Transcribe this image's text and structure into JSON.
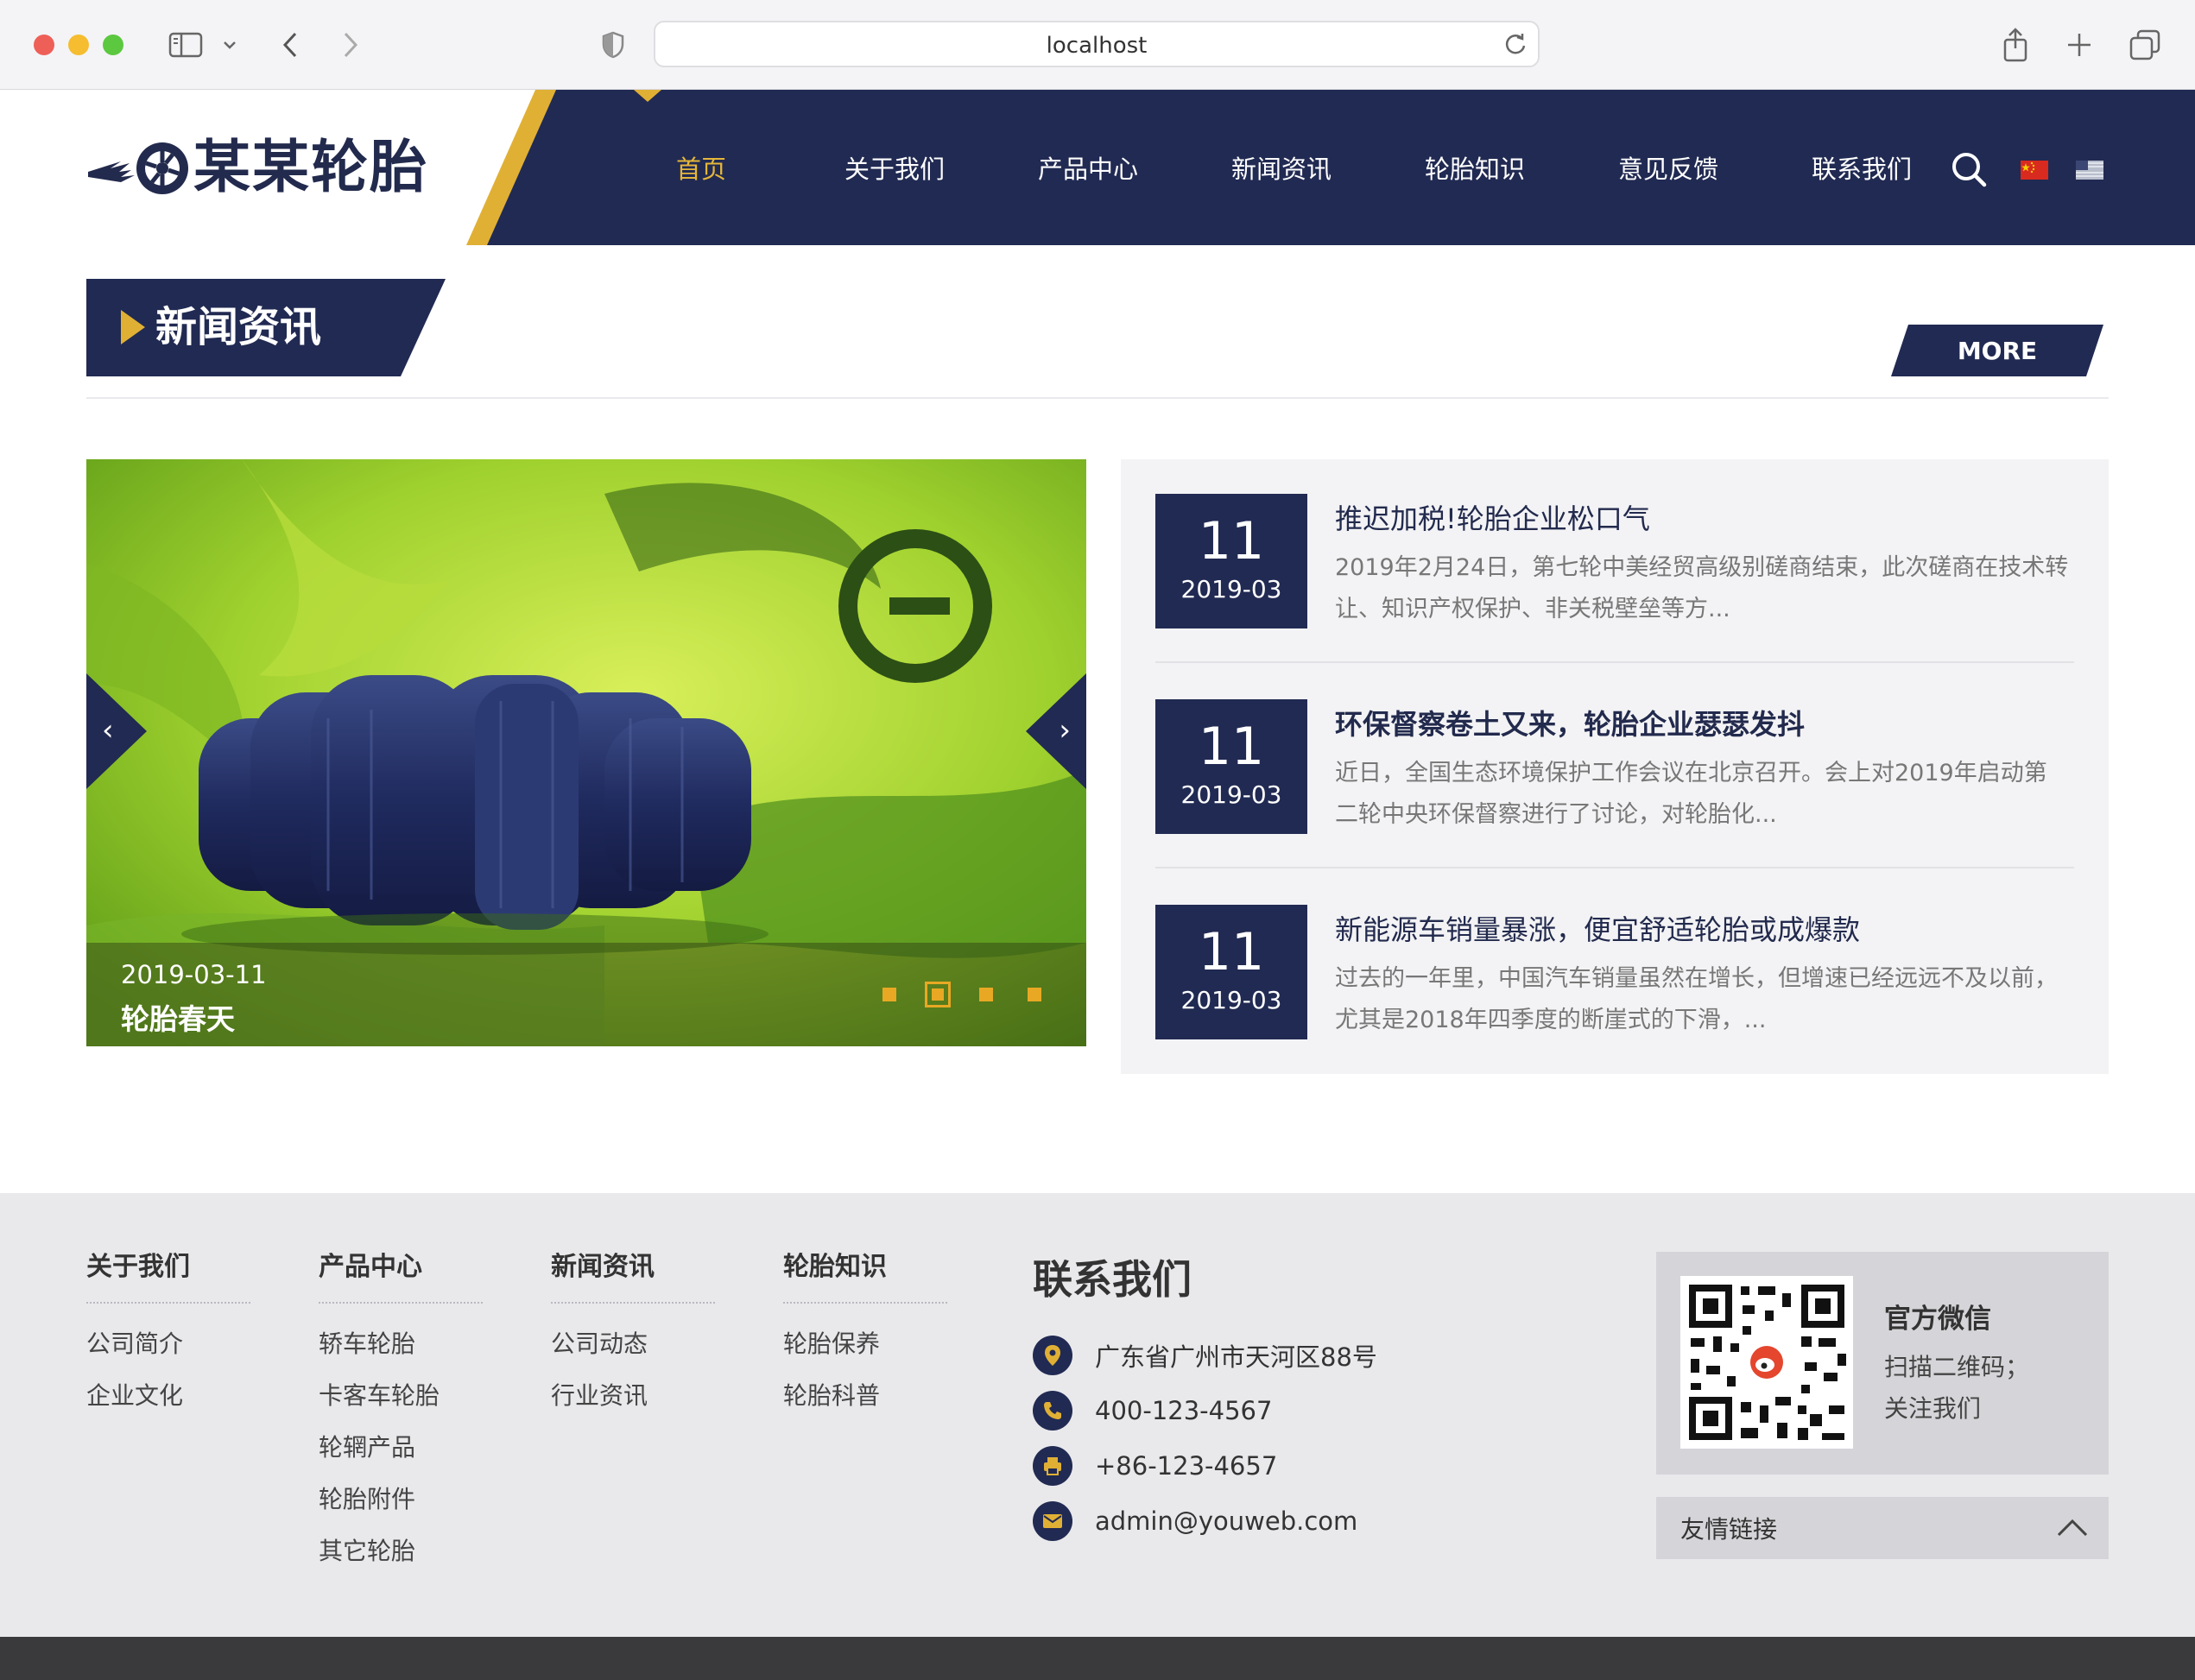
{
  "browser": {
    "url": "localhost"
  },
  "header": {
    "logo_text": "某某轮胎",
    "nav": [
      {
        "label": "首页",
        "active": true
      },
      {
        "label": "关于我们"
      },
      {
        "label": "产品中心"
      },
      {
        "label": "新闻资讯"
      },
      {
        "label": "轮胎知识"
      },
      {
        "label": "意见反馈"
      },
      {
        "label": "联系我们"
      }
    ]
  },
  "news": {
    "section_title": "新闻资讯",
    "more_label": "MORE",
    "slider": {
      "date": "2019-03-11",
      "title": "轮胎春天",
      "slide_count": 4,
      "active_index": 1
    },
    "items": [
      {
        "day": "11",
        "ym": "2019-03",
        "title": "推迟加税!轮胎企业松口气",
        "excerpt": "2019年2月24日，第七轮中美经贸高级别磋商结束，此次磋商在技术转让、知识产权保护、非关税壁垒等方..."
      },
      {
        "day": "11",
        "ym": "2019-03",
        "title": "环保督察卷土又来，轮胎企业瑟瑟发抖",
        "excerpt": "近日，全国生态环境保护工作会议在北京召开。会上对2019年启动第二轮中央环保督察进行了讨论，对轮胎化..."
      },
      {
        "day": "11",
        "ym": "2019-03",
        "title": "新能源车销量暴涨，便宜舒适轮胎或成爆款",
        "excerpt": "过去的一年里，中国汽车销量虽然在增长，但增速已经远远不及以前，尤其是2018年四季度的断崖式的下滑，..."
      }
    ]
  },
  "footer": {
    "columns": [
      {
        "heading": "关于我们",
        "links": [
          "公司简介",
          "企业文化"
        ]
      },
      {
        "heading": "产品中心",
        "links": [
          "轿车轮胎",
          "卡客车轮胎",
          "轮辋产品",
          "轮胎附件",
          "其它轮胎"
        ]
      },
      {
        "heading": "新闻资讯",
        "links": [
          "公司动态",
          "行业资讯"
        ]
      },
      {
        "heading": "轮胎知识",
        "links": [
          "轮胎保养",
          "轮胎科普"
        ]
      }
    ],
    "contact": {
      "title": "联系我们",
      "address": "广东省广州市天河区88号",
      "phone": "400-123-4567",
      "fax": "+86-123-4657",
      "email": "admin@youweb.com"
    },
    "wechat": {
      "title": "官方微信",
      "line1": "扫描二维码；",
      "line2": "关注我们"
    },
    "friend_links_label": "友情链接"
  },
  "colors": {
    "navy": "#212a52",
    "gold": "#e0b035",
    "footer_bg": "#e9e9ec"
  }
}
